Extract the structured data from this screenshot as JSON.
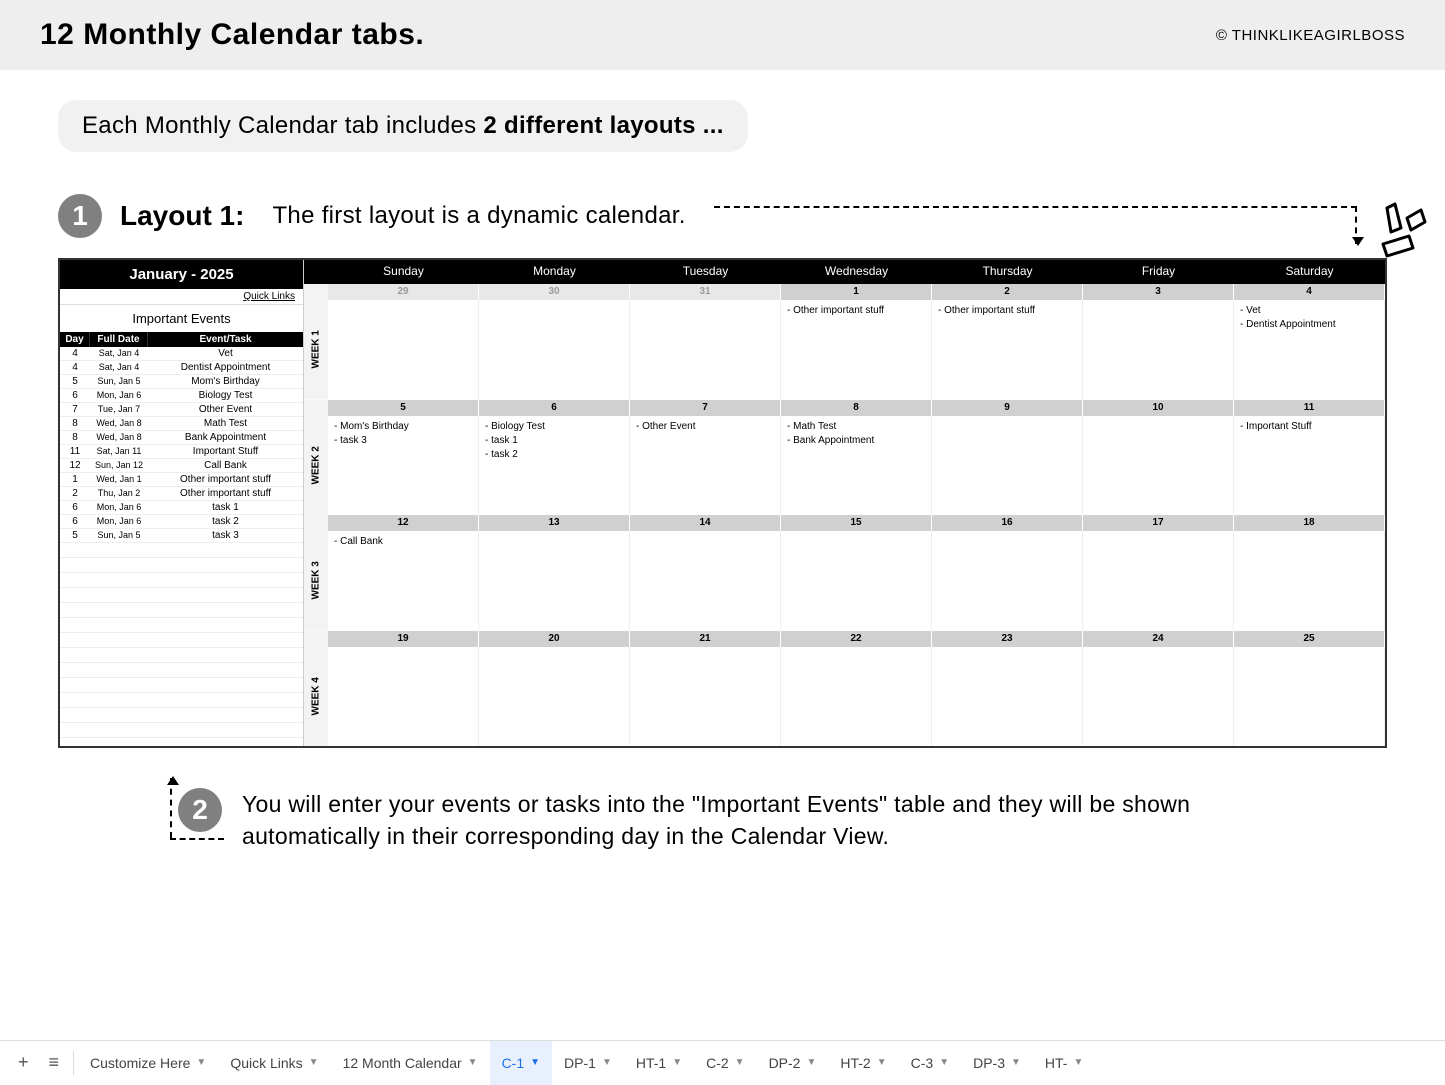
{
  "header": {
    "title": "12 Monthly Calendar tabs.",
    "copyright": "© THINKLIKEAGIRLBOSS"
  },
  "subtitle": {
    "text": "Each Monthly Calendar tab includes ",
    "bold": "2 different layouts ..."
  },
  "layout1": {
    "badge": "1",
    "title": "Layout 1:",
    "desc": "The first layout is a dynamic calendar."
  },
  "calendar": {
    "month": "January - 2025",
    "quick_links": "Quick Links",
    "important_title": "Important Events",
    "columns": {
      "day": "Day",
      "date": "Full Date",
      "event": "Event/Task"
    },
    "day_headers": [
      "Sunday",
      "Monday",
      "Tuesday",
      "Wednesday",
      "Thursday",
      "Friday",
      "Saturday"
    ],
    "week_labels": [
      "WEEK 1",
      "WEEK 2",
      "WEEK 3",
      "WEEK 4"
    ],
    "events": [
      {
        "day": "4",
        "date": "Sat, Jan 4",
        "task": "Vet"
      },
      {
        "day": "4",
        "date": "Sat, Jan 4",
        "task": "Dentist Appointment"
      },
      {
        "day": "5",
        "date": "Sun, Jan 5",
        "task": "Mom's Birthday"
      },
      {
        "day": "6",
        "date": "Mon, Jan 6",
        "task": "Biology Test"
      },
      {
        "day": "7",
        "date": "Tue, Jan 7",
        "task": "Other Event"
      },
      {
        "day": "8",
        "date": "Wed, Jan 8",
        "task": "Math Test"
      },
      {
        "day": "8",
        "date": "Wed, Jan 8",
        "task": "Bank Appointment"
      },
      {
        "day": "11",
        "date": "Sat, Jan 11",
        "task": "Important Stuff"
      },
      {
        "day": "12",
        "date": "Sun, Jan 12",
        "task": "Call Bank"
      },
      {
        "day": "1",
        "date": "Wed, Jan 1",
        "task": "Other important stuff"
      },
      {
        "day": "2",
        "date": "Thu, Jan 2",
        "task": "Other important stuff"
      },
      {
        "day": "6",
        "date": "Mon, Jan 6",
        "task": "task 1"
      },
      {
        "day": "6",
        "date": "Mon, Jan 6",
        "task": "task 2"
      },
      {
        "day": "5",
        "date": "Sun, Jan 5",
        "task": "task 3"
      }
    ],
    "weeks": [
      {
        "dates": [
          {
            "n": "29",
            "prev": true
          },
          {
            "n": "30",
            "prev": true
          },
          {
            "n": "31",
            "prev": true
          },
          {
            "n": "1"
          },
          {
            "n": "2"
          },
          {
            "n": "3"
          },
          {
            "n": "4"
          }
        ],
        "cells": [
          "",
          "",
          "",
          "- Other important stuff",
          "- Other important stuff",
          "",
          "- Vet\n- Dentist Appointment"
        ]
      },
      {
        "dates": [
          {
            "n": "5"
          },
          {
            "n": "6"
          },
          {
            "n": "7"
          },
          {
            "n": "8"
          },
          {
            "n": "9"
          },
          {
            "n": "10"
          },
          {
            "n": "11"
          }
        ],
        "cells": [
          "- Mom's Birthday\n- task 3",
          "- Biology Test\n- task 1\n- task 2",
          "- Other Event",
          "- Math Test\n- Bank Appointment",
          "",
          "",
          "- Important Stuff"
        ]
      },
      {
        "dates": [
          {
            "n": "12"
          },
          {
            "n": "13"
          },
          {
            "n": "14"
          },
          {
            "n": "15"
          },
          {
            "n": "16"
          },
          {
            "n": "17"
          },
          {
            "n": "18"
          }
        ],
        "cells": [
          "- Call Bank",
          "",
          "",
          "",
          "",
          "",
          ""
        ]
      },
      {
        "dates": [
          {
            "n": "19"
          },
          {
            "n": "20"
          },
          {
            "n": "21"
          },
          {
            "n": "22"
          },
          {
            "n": "23"
          },
          {
            "n": "24"
          },
          {
            "n": "25"
          }
        ],
        "cells": [
          "",
          "",
          "",
          "",
          "",
          "",
          ""
        ]
      }
    ]
  },
  "layout2": {
    "badge": "2",
    "desc": "You will enter your events or tasks into the \"Important Events\" table and they will be shown automatically in their corresponding day in the Calendar View."
  },
  "tabs": [
    {
      "label": "Customize Here"
    },
    {
      "label": "Quick Links"
    },
    {
      "label": "12 Month Calendar"
    },
    {
      "label": "C-1",
      "active": true
    },
    {
      "label": "DP-1"
    },
    {
      "label": "HT-1"
    },
    {
      "label": "C-2"
    },
    {
      "label": "DP-2"
    },
    {
      "label": "HT-2"
    },
    {
      "label": "C-3"
    },
    {
      "label": "DP-3"
    },
    {
      "label": "HT-"
    }
  ]
}
